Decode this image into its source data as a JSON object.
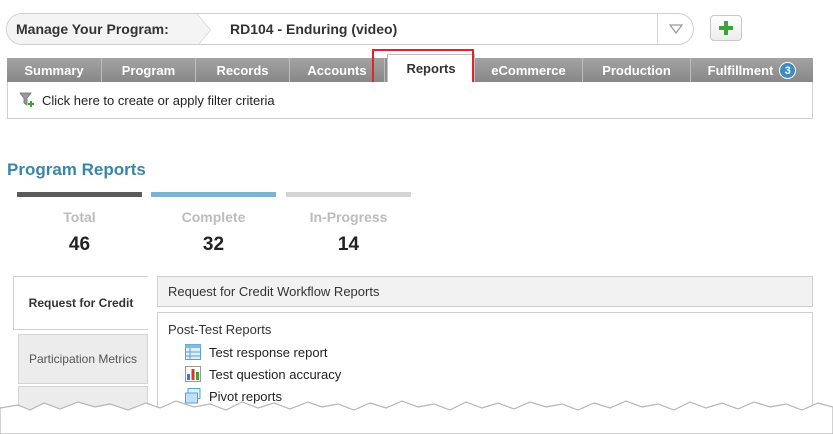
{
  "program": {
    "label": "Manage Your Program:",
    "value": "RD104 - Enduring (video)"
  },
  "tabs": [
    {
      "label": "Summary"
    },
    {
      "label": "Program"
    },
    {
      "label": "Records"
    },
    {
      "label": "Accounts"
    },
    {
      "label": "Reports"
    },
    {
      "label": "eCommerce"
    },
    {
      "label": "Production"
    },
    {
      "label": "Fulfillment",
      "badge": "3"
    }
  ],
  "active_tab": "Reports",
  "filter": {
    "text": "Click here to create or apply filter criteria"
  },
  "page_title": "Program Reports",
  "stats": [
    {
      "label": "Total",
      "value": "46",
      "color": "#5b5b5b"
    },
    {
      "label": "Complete",
      "value": "32",
      "color": "#7db3d1"
    },
    {
      "label": "In-Progress",
      "value": "14",
      "color": "#d4d4d4"
    }
  ],
  "side_tabs": [
    {
      "label": "Request for Credit"
    },
    {
      "label": "Participation Metrics"
    }
  ],
  "panel": {
    "header": "Request for Credit Workflow Reports",
    "group_title": "Post-Test Reports",
    "items": [
      {
        "label": "Test response report",
        "icon": "table-icon"
      },
      {
        "label": "Test question accuracy",
        "icon": "bar-chart-icon"
      },
      {
        "label": "Pivot reports",
        "icon": "pivot-icon"
      }
    ]
  },
  "colors": {
    "accent": "#3a86a8",
    "highlight": "#e0232e",
    "tab_bg": "#8f8f8f",
    "badge": "#3b8cc0",
    "add_green": "#3aa33a"
  }
}
